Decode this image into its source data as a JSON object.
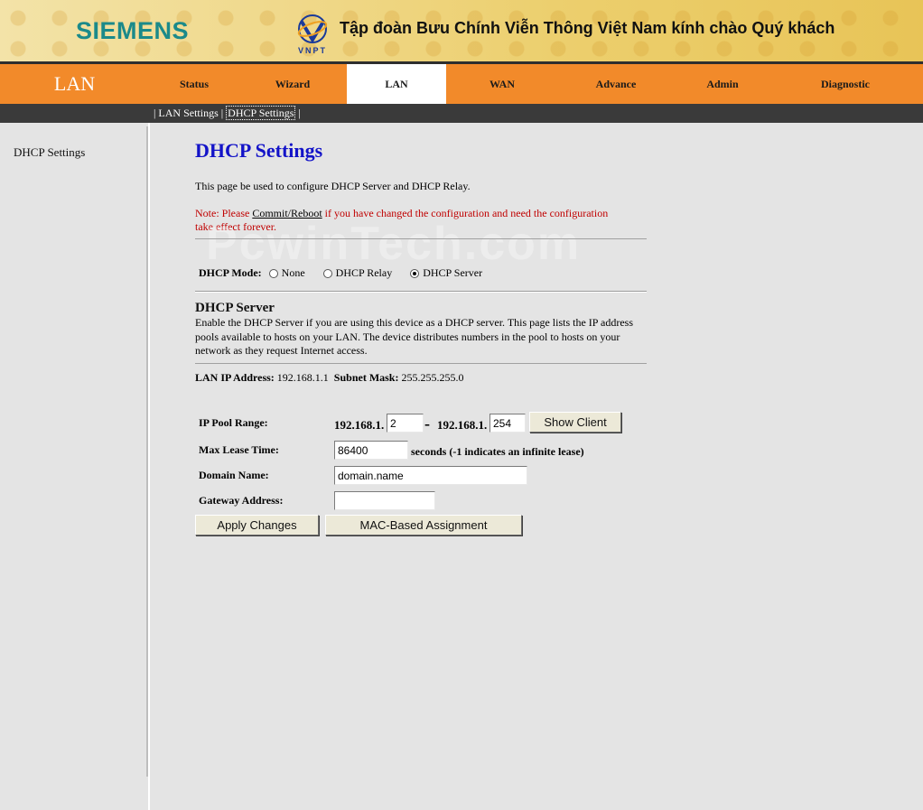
{
  "banner": {
    "brand": "SIEMENS",
    "operator_logo_text": "VNPT",
    "welcome": "Tập đoàn Bưu Chính Viễn Thông Việt Nam kính chào Quý khách"
  },
  "nav": {
    "section_title": "LAN",
    "tabs": [
      {
        "label": "Status"
      },
      {
        "label": "Wizard"
      },
      {
        "label": "LAN"
      },
      {
        "label": "WAN"
      },
      {
        "label": "Advance"
      },
      {
        "label": "Admin"
      },
      {
        "label": "Diagnostic"
      }
    ],
    "active_tab": "LAN"
  },
  "subnav": {
    "items": [
      "LAN Settings",
      "DHCP Settings"
    ],
    "selected": "DHCP Settings"
  },
  "sidebar": {
    "items": [
      {
        "label": "DHCP Settings"
      }
    ]
  },
  "main": {
    "title": "DHCP Settings",
    "description": "This page be used to configure DHCP Server and DHCP Relay.",
    "note_prefix": "Note: Please ",
    "note_link": "Commit/Reboot",
    "note_suffix": " if you have changed the configuration and need the configuration take effect forever.",
    "watermark": "PcwinTech.com",
    "dhcp_mode": {
      "label": "DHCP Mode:",
      "options": [
        "None",
        "DHCP Relay",
        "DHCP Server"
      ],
      "selected": "DHCP Server"
    },
    "server": {
      "title": "DHCP Server",
      "description": "Enable the DHCP Server if you are using this device as a DHCP server. This page lists the IP address pools available to hosts on your LAN. The device distributes numbers in the pool to hosts on your network as they request Internet access."
    },
    "lan_ip_label": "LAN IP Address:",
    "lan_ip": "192.168.1.1",
    "subnet_label": "Subnet Mask:",
    "subnet": "255.255.255.0",
    "form": {
      "pool_label": "IP Pool Range:",
      "pool_prefix_start": "192.168.1.",
      "pool_start": "2",
      "pool_dash": "-",
      "pool_prefix_end": "192.168.1.",
      "pool_end": "254",
      "show_client": "Show Client",
      "lease_label": "Max Lease Time:",
      "lease_value": "86400",
      "lease_hint": "seconds (-1 indicates an infinite lease)",
      "domain_label": "Domain Name:",
      "domain_value": "domain.name",
      "gateway_label": "Gateway Address:",
      "gateway_value": "",
      "apply": "Apply Changes",
      "mac_assign": "MAC-Based Assignment"
    }
  }
}
